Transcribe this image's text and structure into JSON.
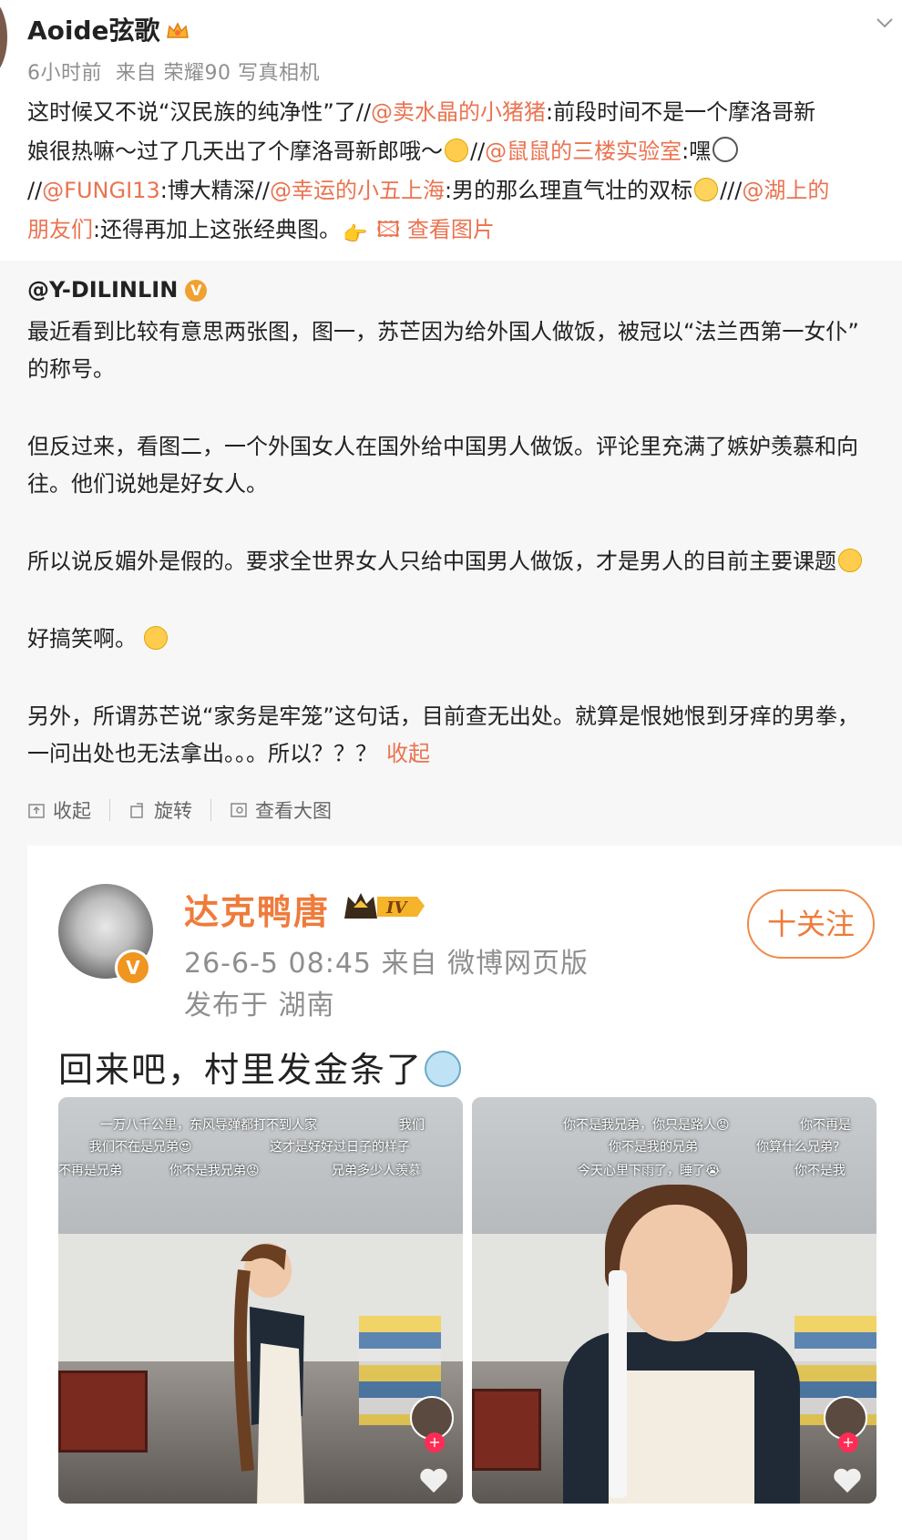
{
  "post": {
    "username": "Aoide弦歌",
    "time": "6小时前",
    "source": "来自 荣耀90 写真相机",
    "lines": [
      [
        {
          "t": "这时候又不说“汉民族的纯净性”了//"
        },
        {
          "t": "@卖水晶的小猪猪",
          "m": true
        },
        {
          "t": ":前段时间不是一个摩洛哥新"
        }
      ],
      [
        {
          "t": "娘很热嘛～过了几天出了个摩洛哥新郎哦～"
        },
        {
          "e": "grin"
        },
        {
          "t": "//"
        },
        {
          "t": "@鼠鼠的三楼实验室",
          "m": true
        },
        {
          "t": ":嘿"
        },
        {
          "e": "shock"
        }
      ],
      [
        {
          "t": "//"
        },
        {
          "t": "@FUNGI13",
          "m": true
        },
        {
          "t": ":博大精深//"
        },
        {
          "t": "@幸运的小五上海",
          "m": true
        },
        {
          "t": ":男的那么理直气壮的双标"
        },
        {
          "e": "sweat"
        },
        {
          "t": "///"
        },
        {
          "t": "@湖上的",
          "m": true
        }
      ],
      [
        {
          "t": "朋友们",
          "m": true
        },
        {
          "t": ":还得再加上这张经典图。"
        },
        {
          "e": "point"
        },
        {
          "t": " "
        },
        {
          "t": "🖾 查看图片",
          "m": true
        }
      ]
    ]
  },
  "repost": {
    "author": "@Y-DILINLIN",
    "badge": "V",
    "paragraphs": [
      [
        "最近看到比较有意思两张图，图一，苏芒因为给外国人做饭，被冠以“法兰西第一女仆”",
        "的称号。"
      ],
      [
        "但反过来，看图二，一个外国女人在国外给中国男人做饭。评论里充满了嫉妒羡慕和向",
        "往。他们说她是好女人。"
      ],
      [
        "所以说反媚外是假的。要求全世界女人只给中国男人做饭，才是男人的目前主要课题"
      ],
      [
        "好搞笑啊。"
      ],
      [
        "另外，所谓苏芒说“家务是牢笼”这句话，目前查无出处。就算是恨她恨到牙痒的男拳，",
        "一问出处也无法拿出。。。所以？？？"
      ]
    ],
    "collapse_link": "收起",
    "tools": {
      "collapse": "收起",
      "rotate": "旋转",
      "view_large": "查看大图"
    }
  },
  "screenshot": {
    "name": "达克鸭唐",
    "level": "IV",
    "avatar_badge": "V",
    "meta_time_source": "26-6-5 08:45   来自 微博网页版",
    "meta_location": "发布于 湖南",
    "follow_button": "十关注",
    "title": "回来吧，村里发金条了",
    "video_left_captions": [
      "一万八千公里，东风导弹都打不到人家",
      "我们不在是兄弟😍",
      "这才是好好过日子的样子",
      "不再是兄弟",
      "你不是我兄弟😡",
      "兄弟多少人羡慕",
      "我们"
    ],
    "video_right_captions": [
      "你不是我兄弟，你只是路人😡",
      "你不再是",
      "你不是我的兄弟",
      "你算什么兄弟?",
      "今天心里下雨了，睡了😭",
      "你不是我"
    ]
  },
  "colors": {
    "accent": "#eb7350",
    "repost_bg": "#f7f7f7"
  }
}
